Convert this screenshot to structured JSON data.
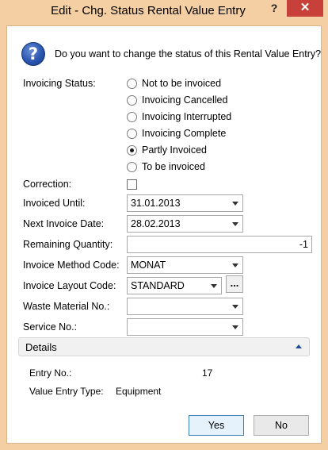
{
  "window": {
    "title": "Edit - Chg. Status Rental Value Entry",
    "help_glyph": "?",
    "close_glyph": "✕"
  },
  "prompt": {
    "icon": "question-icon",
    "glyph": "?",
    "text": "Do you want to change the status of this Rental Value Entry?"
  },
  "form": {
    "invoicing_status": {
      "label": "Invoicing Status:",
      "options": [
        {
          "label": "Not to be invoiced",
          "selected": false
        },
        {
          "label": "Invoicing Cancelled",
          "selected": false
        },
        {
          "label": "Invoicing Interrupted",
          "selected": false
        },
        {
          "label": "Invoicing Complete",
          "selected": false
        },
        {
          "label": "Partly Invoiced",
          "selected": true
        },
        {
          "label": "To be invoiced",
          "selected": false
        }
      ]
    },
    "correction": {
      "label": "Correction:",
      "checked": false
    },
    "invoiced_until": {
      "label": "Invoiced Until:",
      "value": "31.01.2013"
    },
    "next_invoice_date": {
      "label": "Next Invoice Date:",
      "value": "28.02.2013"
    },
    "remaining_quantity": {
      "label": "Remaining Quantity:",
      "value": "-1"
    },
    "invoice_method_code": {
      "label": "Invoice Method Code:",
      "value": "MONAT"
    },
    "invoice_layout_code": {
      "label": "Invoice Layout Code:",
      "value": "STANDARD",
      "lookup_label": "..."
    },
    "waste_material_no": {
      "label": "Waste Material No.:",
      "value": ""
    },
    "service_no": {
      "label": "Service No.:",
      "value": ""
    }
  },
  "details": {
    "title": "Details",
    "entry_no": {
      "label": "Entry No.:",
      "value": "17"
    },
    "value_entry_type": {
      "label": "Value Entry Type:",
      "value": "Equipment"
    }
  },
  "buttons": {
    "yes": "Yes",
    "no": "No"
  },
  "colors": {
    "frame": "#f5cfa4",
    "close": "#c7403a",
    "accent": "#1f4f9b"
  }
}
